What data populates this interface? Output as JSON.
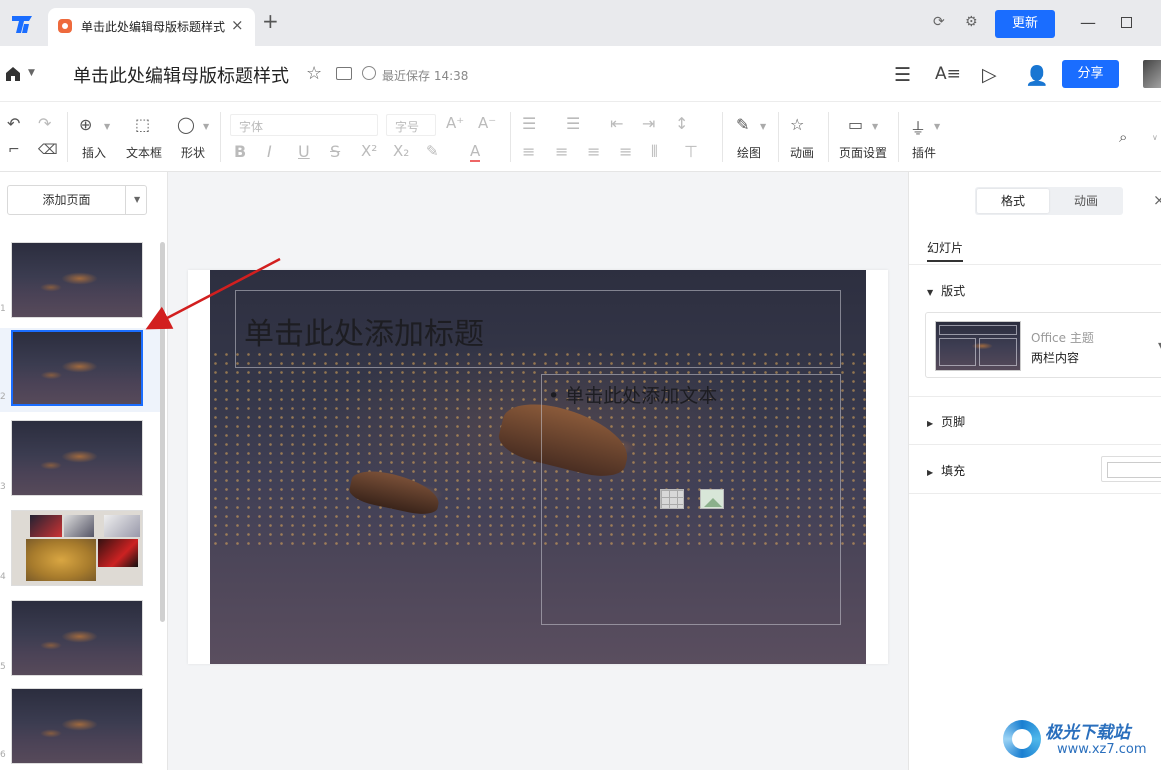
{
  "titlebar": {
    "tab_label": "单击此处编辑母版标题样式",
    "tab_close": "×",
    "new_tab": "+",
    "update_label": "更新",
    "minimize": "—"
  },
  "header": {
    "doc_title": "单击此处编辑母版标题样式",
    "saved_text": "最近保存 14:38",
    "share_label": "分享"
  },
  "ribbon": {
    "insert_label": "插入",
    "textbox_label": "文本框",
    "shape_label": "形状",
    "font_placeholder": "字体",
    "size_placeholder": "字号",
    "draw_label": "绘图",
    "animation_label": "动画",
    "page_setup_label": "页面设置",
    "plugin_label": "插件"
  },
  "left_panel": {
    "add_page_label": "添加页面",
    "slides": [
      {
        "num": "1",
        "kind": "night-boat"
      },
      {
        "num": "2",
        "kind": "night-boat",
        "selected": true
      },
      {
        "num": "3",
        "kind": "night-boat"
      },
      {
        "num": "4",
        "kind": "collage"
      },
      {
        "num": "5",
        "kind": "night-boat"
      },
      {
        "num": "6",
        "kind": "night-boat"
      }
    ]
  },
  "slide": {
    "title_placeholder": "单击此处添加标题",
    "body_placeholder": "单击此处添加文本",
    "bullet": "•"
  },
  "right_panel": {
    "tab_format": "格式",
    "tab_animation": "动画",
    "close": "×",
    "section_tab": "幻灯片",
    "layout_section": "版式",
    "layout_theme": "Office 主题",
    "layout_name": "两栏内容",
    "footer_section": "页脚",
    "fill_section": "填充"
  },
  "watermark": {
    "name": "极光下载站",
    "url": "www.xz7.com"
  },
  "colors": {
    "accent": "#1a6dff",
    "annotation_arrow": "#d21f1f"
  }
}
